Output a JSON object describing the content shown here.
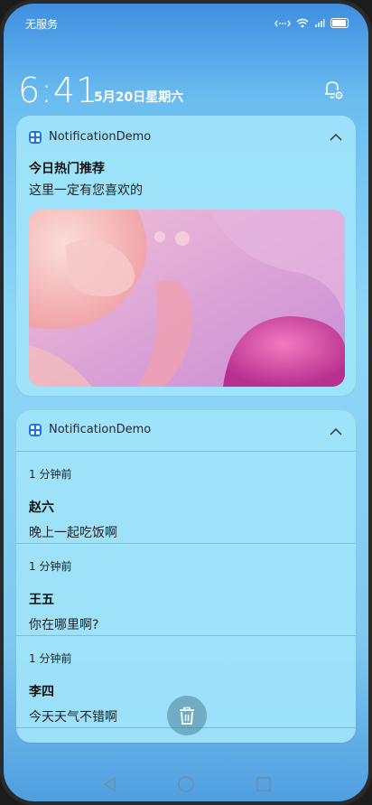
{
  "status_bar": {
    "carrier": "无服务",
    "icons": [
      "signal-link-icon",
      "wifi-icon",
      "no-signal-icon",
      "battery-icon"
    ]
  },
  "lock_header": {
    "time": "6:41",
    "date": "5月20日星期六",
    "settings_icon": "bell-settings-icon"
  },
  "notifications": [
    {
      "app_name": "NotificationDemo",
      "title": "今日热门推荐",
      "text": "这里一定有您喜欢的",
      "has_picture": true
    }
  ],
  "group": {
    "app_name": "NotificationDemo",
    "items": [
      {
        "time_ago": "1 分钟前",
        "sender": "赵六",
        "message": "晚上一起吃饭啊"
      },
      {
        "time_ago": "1 分钟前",
        "sender": "王五",
        "message": "你在哪里啊?"
      },
      {
        "time_ago": "1 分钟前",
        "sender": "李四",
        "message": "今天天气不错啊"
      }
    ]
  },
  "actions": {
    "clear_icon": "trash-icon"
  },
  "nav": {
    "icons": [
      "back-icon",
      "home-icon",
      "recents-icon"
    ]
  }
}
